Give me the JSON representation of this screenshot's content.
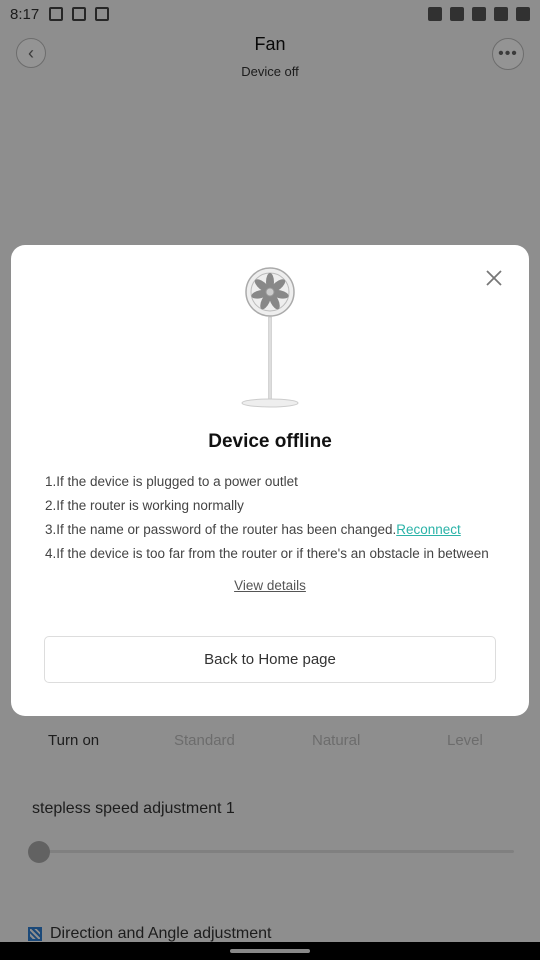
{
  "status_bar": {
    "time": "8:17",
    "left_icons": [
      "image-icon",
      "cat-face-icon",
      "app-icon"
    ],
    "right_icons": [
      "alarm-icon",
      "vibrate-icon",
      "wifi-icon",
      "signal-icon",
      "battery-icon"
    ]
  },
  "header": {
    "title": "Fan",
    "subtitle": "Device off",
    "back_icon": "chevron-left-icon",
    "more_icon": "more-dots-icon"
  },
  "modes": [
    {
      "label": "Turn on",
      "active": true
    },
    {
      "label": "Standard",
      "active": false
    },
    {
      "label": "Natural",
      "active": false
    },
    {
      "label": "Level",
      "active": false
    }
  ],
  "speed": {
    "label": "stepless speed adjustment 1",
    "value": 1
  },
  "direction": {
    "label": "Direction and Angle adjustment"
  },
  "dialog": {
    "title": "Device offline",
    "close_icon": "close-icon",
    "reasons": [
      "1.If the device is plugged to a power outlet",
      "2.If the router is working normally",
      "3.If the name or password of the router has been changed.",
      "4.If the device is too far from the router or if there's an obstacle in between"
    ],
    "reconnect_label": "Reconnect",
    "view_details_label": "View details",
    "home_button_label": "Back to Home page"
  },
  "colors": {
    "accent_link": "#2bb3a8",
    "overlay": "rgba(0,0,0,0.42)",
    "direction_icon": "#2f7fd0"
  }
}
